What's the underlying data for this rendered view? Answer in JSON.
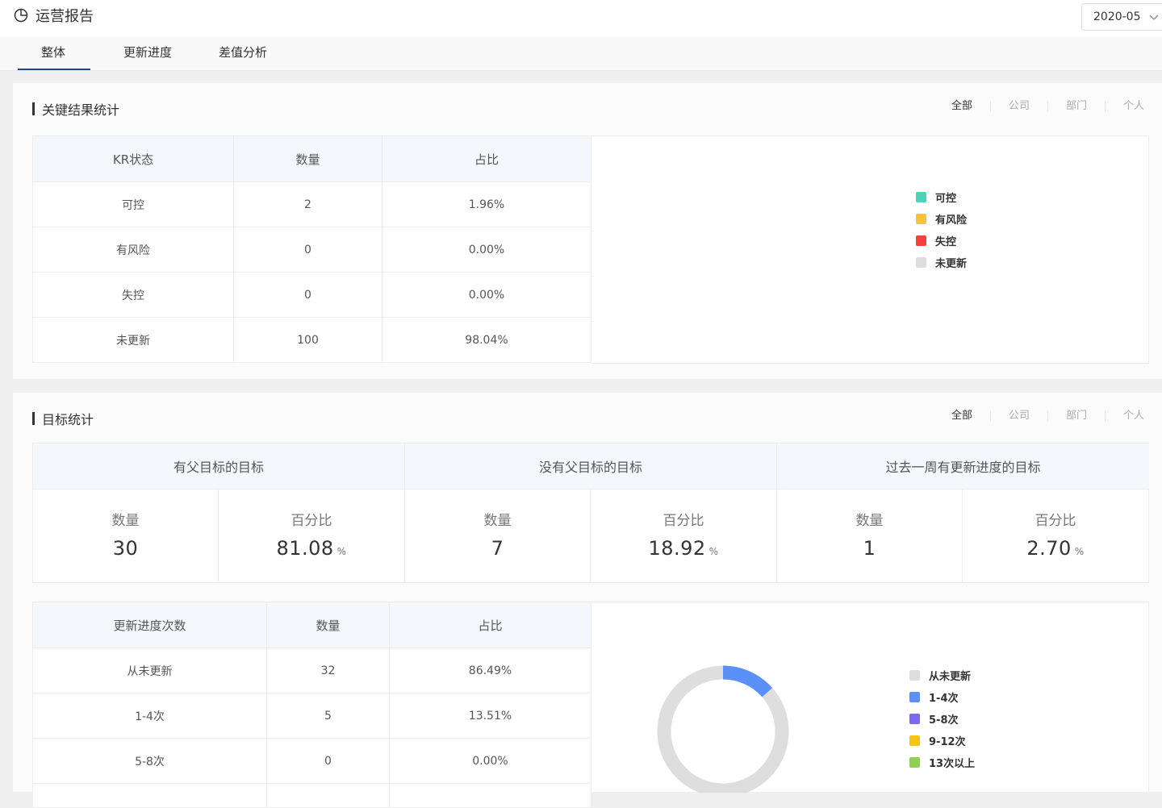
{
  "header": {
    "title": "运营报告",
    "month": "2020-05"
  },
  "tabs": [
    "整体",
    "更新进度",
    "差值分析"
  ],
  "filters": [
    "全部",
    "公司",
    "部门",
    "个人"
  ],
  "kr_section": {
    "title": "关键结果统计",
    "columns": [
      "KR状态",
      "数量",
      "占比"
    ],
    "rows": [
      [
        "可控",
        "2",
        "1.96%"
      ],
      [
        "有风险",
        "0",
        "0.00%"
      ],
      [
        "失控",
        "0",
        "0.00%"
      ],
      [
        "未更新",
        "100",
        "98.04%"
      ]
    ],
    "legend": [
      {
        "label": "可控",
        "color": "#4fd1b8"
      },
      {
        "label": "有风险",
        "color": "#f7c23c"
      },
      {
        "label": "失控",
        "color": "#f0443a"
      },
      {
        "label": "未更新",
        "color": "#dedede"
      }
    ]
  },
  "goal_section": {
    "title": "目标统计",
    "groups": [
      {
        "header": "有父目标的目标",
        "count_label": "数量",
        "count": "30",
        "pct_label": "百分比",
        "pct": "81.08",
        "unit": "%"
      },
      {
        "header": "没有父目标的目标",
        "count_label": "数量",
        "count": "7",
        "pct_label": "百分比",
        "pct": "18.92",
        "unit": "%"
      },
      {
        "header": "过去一周有更新进度的目标",
        "count_label": "数量",
        "count": "1",
        "pct_label": "百分比",
        "pct": "2.70",
        "unit": "%"
      }
    ],
    "update_table": {
      "columns": [
        "更新进度次数",
        "数量",
        "占比"
      ],
      "rows": [
        [
          "从未更新",
          "32",
          "86.49%"
        ],
        [
          "1-4次",
          "5",
          "13.51%"
        ],
        [
          "5-8次",
          "0",
          "0.00%"
        ]
      ]
    },
    "legend": [
      {
        "label": "从未更新",
        "color": "#dedede"
      },
      {
        "label": "1-4次",
        "color": "#5b8ff9"
      },
      {
        "label": "5-8次",
        "color": "#7a6cf0"
      },
      {
        "label": "9-12次",
        "color": "#f6c514"
      },
      {
        "label": "13次以上",
        "color": "#8fd14f"
      }
    ]
  },
  "chart_data": {
    "type": "pie",
    "categories": [
      "从未更新",
      "1-4次",
      "5-8次",
      "9-12次",
      "13次以上"
    ],
    "values": [
      32,
      5,
      0,
      0,
      0
    ],
    "colors": [
      "#dedede",
      "#5b8ff9",
      "#7a6cf0",
      "#f6c514",
      "#8fd14f"
    ],
    "donut": true
  }
}
